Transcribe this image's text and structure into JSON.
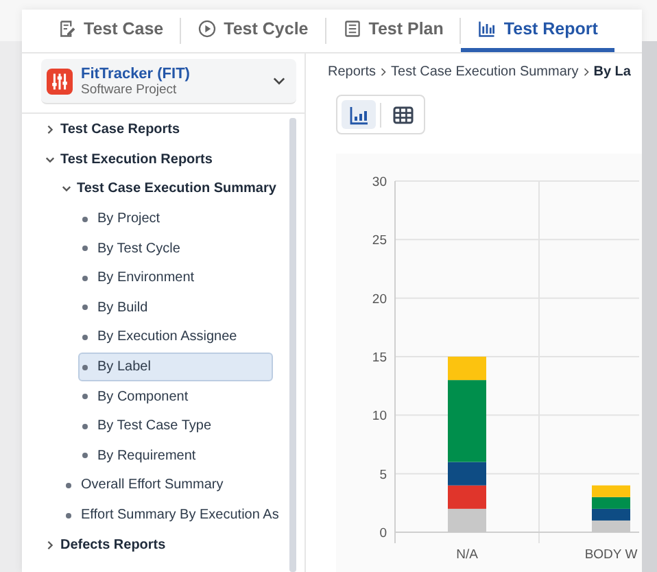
{
  "tabs": [
    {
      "label": "Test Case",
      "selected": false
    },
    {
      "label": "Test Cycle",
      "selected": false
    },
    {
      "label": "Test Plan",
      "selected": false
    },
    {
      "label": "Test Report",
      "selected": true
    }
  ],
  "project": {
    "name": "FitTracker (FIT)",
    "type": "Software Project"
  },
  "tree": [
    {
      "label": "Test Case Reports",
      "kind": "group",
      "expanded": false
    },
    {
      "label": "Test Execution Reports",
      "kind": "group",
      "expanded": true,
      "children": [
        {
          "label": "Test Case Execution Summary",
          "kind": "group",
          "expanded": true,
          "children": [
            {
              "label": "By Project",
              "kind": "leaf",
              "selected": false
            },
            {
              "label": "By Test Cycle",
              "kind": "leaf",
              "selected": false
            },
            {
              "label": "By Environment",
              "kind": "leaf",
              "selected": false
            },
            {
              "label": "By Build",
              "kind": "leaf",
              "selected": false
            },
            {
              "label": "By Execution Assignee",
              "kind": "leaf",
              "selected": false
            },
            {
              "label": "By Label",
              "kind": "leaf",
              "selected": true
            },
            {
              "label": "By Component",
              "kind": "leaf",
              "selected": false
            },
            {
              "label": "By Test Case Type",
              "kind": "leaf",
              "selected": false
            },
            {
              "label": "By Requirement",
              "kind": "leaf",
              "selected": false
            }
          ]
        },
        {
          "label": "Overall Effort Summary",
          "kind": "leaf",
          "selected": false
        },
        {
          "label": "Effort Summary By Execution As",
          "kind": "leaf",
          "selected": false
        }
      ]
    },
    {
      "label": "Defects Reports",
      "kind": "group",
      "expanded": false
    }
  ],
  "breadcrumb": [
    {
      "label": "Reports",
      "current": false
    },
    {
      "label": "Test Case Execution Summary",
      "current": false
    },
    {
      "label": "By La",
      "current": true
    }
  ],
  "view_toggle": [
    {
      "kind": "chart",
      "selected": true
    },
    {
      "kind": "table",
      "selected": false
    }
  ],
  "chart_data": {
    "type": "bar",
    "stacked": true,
    "grid": true,
    "categories": [
      "N/A",
      "BODY W"
    ],
    "ylim": [
      0,
      30
    ],
    "yticks": [
      0,
      5,
      10,
      15,
      20,
      25,
      30
    ],
    "series": [
      {
        "color": "#c8c8c8",
        "values": [
          2,
          1
        ]
      },
      {
        "color": "#e0352b",
        "values": [
          2,
          0
        ]
      },
      {
        "color": "#0e4c84",
        "values": [
          2,
          1
        ]
      },
      {
        "color": "#008f4c",
        "values": [
          7,
          1
        ]
      },
      {
        "color": "#fcc30f",
        "values": [
          2,
          1
        ]
      }
    ]
  }
}
